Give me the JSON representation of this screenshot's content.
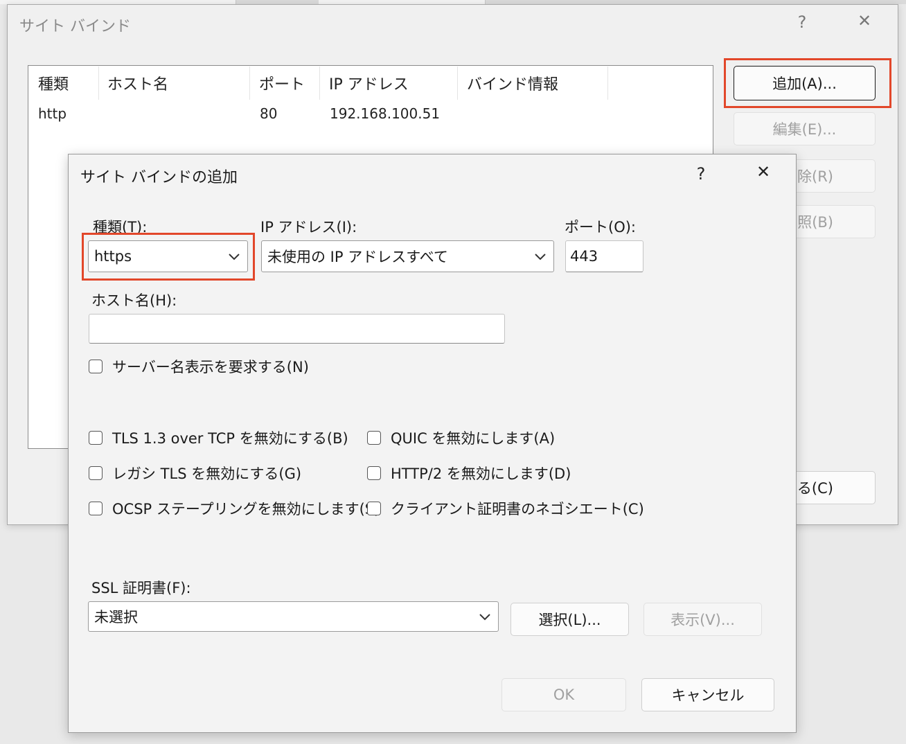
{
  "site_bindings": {
    "title": "サイト バインド",
    "help_symbol": "?",
    "close_symbol": "✕",
    "columns": [
      "種類",
      "ホスト名",
      "ポート",
      "IP アドレス",
      "バインド情報"
    ],
    "rows": [
      {
        "type": "http",
        "host": "",
        "port": "80",
        "ip": "192.168.100.51",
        "binding_info": ""
      }
    ],
    "buttons": {
      "add": "追加(A)...",
      "edit": "編集(E)...",
      "remove_partial": "除(R)",
      "browse_partial": "照(B)",
      "close_partial": "じる(C)"
    }
  },
  "add_binding": {
    "title": "サイト バインドの追加",
    "help_symbol": "?",
    "close_symbol": "✕",
    "type_label": "種類(T):",
    "type_value": "https",
    "ip_label": "IP アドレス(I):",
    "ip_value": "未使用の IP アドレスすべて",
    "port_label": "ポート(O):",
    "port_value": "443",
    "host_label": "ホスト名(H):",
    "host_value": "",
    "sni_label": "サーバー名表示を要求する(N)",
    "options_left": [
      "TLS 1.3 over TCP を無効にする(B)",
      "レガシ TLS を無効にする(G)",
      "OCSP ステープリングを無効にします(S)"
    ],
    "options_right": [
      "QUIC を無効にします(A)",
      "HTTP/2 を無効にします(D)",
      "クライアント証明書のネゴシエート(C)"
    ],
    "ssl_label": "SSL 証明書(F):",
    "ssl_value": "未選択",
    "select_button": "選択(L)...",
    "view_button": "表示(V)...",
    "ok_button": "OK",
    "cancel_button": "キャンセル"
  },
  "colors": {
    "highlight": "#e2472a",
    "disabled_text": "#a0a0a0"
  }
}
